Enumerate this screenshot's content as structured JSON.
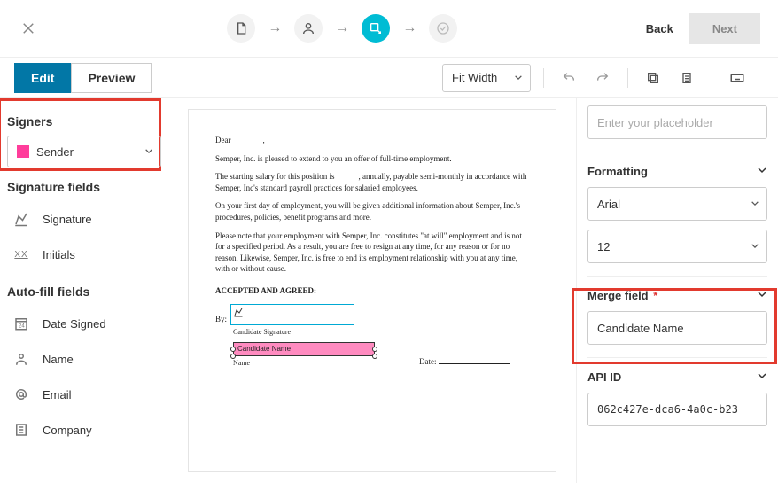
{
  "topbar": {
    "back": "Back",
    "next": "Next"
  },
  "tabs": {
    "edit": "Edit",
    "preview": "Preview"
  },
  "zoom": {
    "value": "Fit Width"
  },
  "left": {
    "signers_label": "Signers",
    "signer_value": "Sender",
    "sig_fields_label": "Signature fields",
    "signature": "Signature",
    "initials": "Initials",
    "autofill_label": "Auto-fill fields",
    "date_signed": "Date Signed",
    "name": "Name",
    "email": "Email",
    "company": "Company"
  },
  "doc": {
    "greeting": "Dear",
    "p1": "Semper, Inc. is pleased to extend to you an offer of full-time employment.",
    "p2a": "The starting salary for this position is",
    "p2b": ", annually, payable semi-monthly in accordance with Semper, Inc's standard payroll practices for salaried employees.",
    "p3": "On your first day of employment, you will be given additional information about Semper, Inc.'s procedures, policies, benefit programs and more.",
    "p4": "Please note that your employment with Semper, Inc. constitutes \"at will\" employment and is not for a specified period. As a result, you are free to resign at any time, for any reason or for no reason. Likewise, Semper, Inc. is free to end its employment relationship with you at any time, with or without cause.",
    "accepted": "ACCEPTED AND AGREED:",
    "by": "By:",
    "candidate_sig": "Candidate Signature",
    "date": "Date:",
    "merge_chip": "Candidate Name",
    "name_cap": "Name"
  },
  "right": {
    "placeholder_ph": "Enter your placeholder",
    "formatting_label": "Formatting",
    "font_value": "Arial",
    "size_value": "12",
    "merge_label": "Merge field",
    "merge_value": "Candidate Name",
    "api_label": "API ID",
    "api_value": "062c427e-dca6-4a0c-b23"
  }
}
